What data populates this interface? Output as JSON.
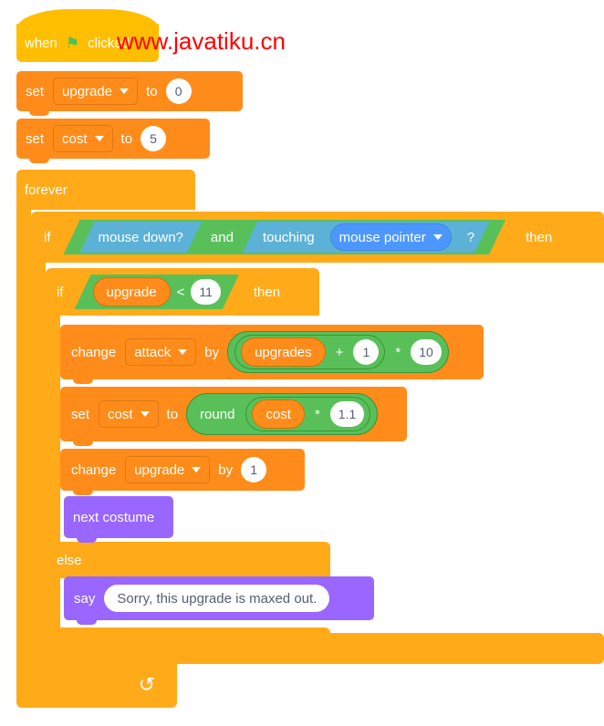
{
  "watermark": {
    "text": "www.javatiku.cn",
    "color": "#FF0000"
  },
  "palette": {
    "events": "#FFBF00",
    "control": "#FFAB19",
    "variables": "#FF8C1A",
    "looks": "#9966FF",
    "operators": "#59C059",
    "sensing": "#5CB1D6",
    "input_text": "#575E75"
  },
  "script": {
    "hat": {
      "when_label": "when",
      "flag_icon": "green-flag-icon",
      "clicked_label": "clicked"
    },
    "set_upgrade": {
      "verb": "set",
      "variable": "upgrade",
      "to_label": "to",
      "value": "0"
    },
    "set_cost": {
      "verb": "set",
      "variable": "cost",
      "to_label": "to",
      "value": "5"
    },
    "forever": {
      "label": "forever",
      "loop_icon": "loop-arrow-icon"
    },
    "if_mouse": {
      "if_label": "if",
      "then_label": "then",
      "condition": {
        "operator": "and",
        "left": "mouse down?",
        "right": {
          "verb": "touching",
          "target": "mouse pointer",
          "suffix": "?"
        }
      }
    },
    "if_upgrade": {
      "if_label": "if",
      "then_label": "then",
      "else_label": "else",
      "condition": {
        "left_variable": "upgrade",
        "operator": "<",
        "right_value": "11"
      }
    },
    "change_attack": {
      "verb": "change",
      "variable": "attack",
      "by_label": "by",
      "expression": {
        "outer_operator": "*",
        "outer_right": "10",
        "inner_operator": "+",
        "inner_left_variable": "upgrades",
        "inner_right": "1"
      }
    },
    "set_cost_round": {
      "verb": "set",
      "variable": "cost",
      "to_label": "to",
      "expression": {
        "function": "round",
        "operator": "*",
        "left_variable": "cost",
        "right_value": "1.1"
      }
    },
    "change_upgrade": {
      "verb": "change",
      "variable": "upgrade",
      "by_label": "by",
      "value": "1"
    },
    "next_costume": {
      "label": "next costume"
    },
    "say": {
      "verb": "say",
      "message": "Sorry, this upgrade is maxed out."
    }
  }
}
